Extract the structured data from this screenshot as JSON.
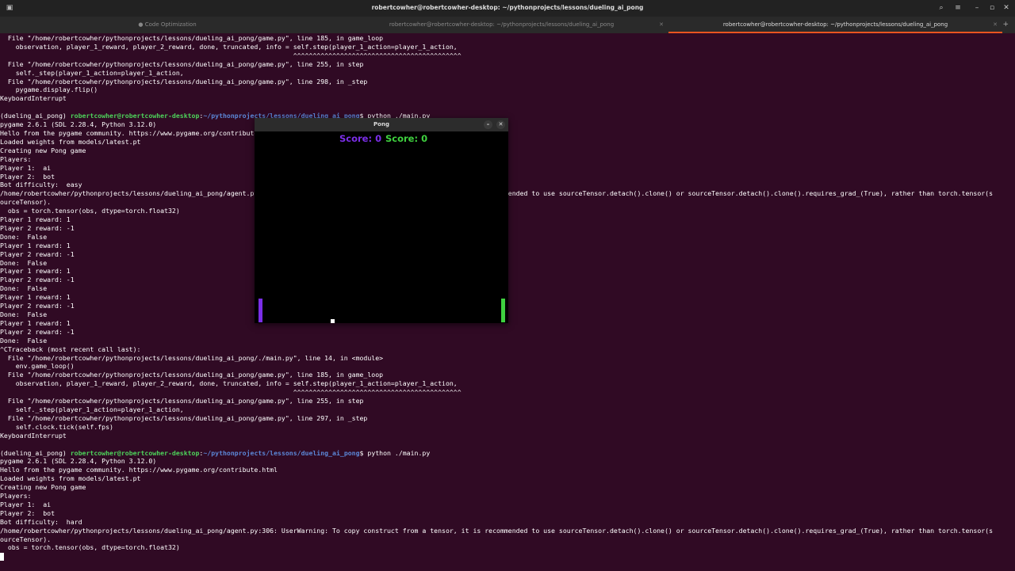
{
  "window": {
    "title": "robertcowher@robertcowher-desktop: ~/pythonprojects/lessons/dueling_ai_pong"
  },
  "tabs": [
    {
      "label": "Code Optimization",
      "prefix": "● ",
      "active": false
    },
    {
      "label": "robertcowher@robertcowher-desktop: ~/pythonprojects/lessons/dueling_ai_pong",
      "prefix": "",
      "active": false
    },
    {
      "label": "robertcowher@robertcowher-desktop: ~/pythonprojects/lessons/dueling_ai_pong",
      "prefix": "",
      "active": true
    }
  ],
  "prompt": {
    "env": "(dueling_ai_pong)",
    "user": "robertcowher@robertcowher-desktop",
    "path": "~/pythonprojects/lessons/dueling_ai_pong"
  },
  "terminal_lines": [
    "  File \"/home/robertcowher/pythonprojects/lessons/dueling_ai_pong/game.py\", line 185, in game_loop",
    "    observation, player_1_reward, player_2_reward, done, truncated, info = self.step(player_1_action=player_1_action,",
    "                                                                           ^^^^^^^^^^^^^^^^^^^^^^^^^^^^^^^^^^^^^^^^^^^",
    "  File \"/home/robertcowher/pythonprojects/lessons/dueling_ai_pong/game.py\", line 255, in step",
    "    self._step(player_1_action=player_1_action,",
    "  File \"/home/robertcowher/pythonprojects/lessons/dueling_ai_pong/game.py\", line 298, in _step",
    "    pygame.display.flip()",
    "KeyboardInterrupt",
    "",
    {
      "prompt": true,
      "cmd": "$ python ./main.py"
    },
    "pygame 2.6.1 (SDL 2.28.4, Python 3.12.0)",
    "Hello from the pygame community. https://www.pygame.org/contribute.html",
    "Loaded weights from models/latest.pt",
    "Creating new Pong game",
    "Players:",
    "Player 1:  ai",
    "Player 2:  bot",
    "Bot difficulty:  easy",
    "/home/robertcowher/pythonprojects/lessons/dueling_ai_pong/agent.py:306: UserWarning: To copy construct from a tensor, it is recommended to use sourceTensor.detach().clone() or sourceTensor.detach().clone().requires_grad_(True), rather than torch.tensor(s",
    "ourceTensor).",
    "  obs = torch.tensor(obs, dtype=torch.float32)",
    "Player 1 reward: 1",
    "Player 2 reward: -1",
    "Done:  False",
    "Player 1 reward: 1",
    "Player 2 reward: -1",
    "Done:  False",
    "Player 1 reward: 1",
    "Player 2 reward: -1",
    "Done:  False",
    "Player 1 reward: 1",
    "Player 2 reward: -1",
    "Done:  False",
    "Player 1 reward: 1",
    "Player 2 reward: -1",
    "Done:  False",
    "^CTraceback (most recent call last):",
    "  File \"/home/robertcowher/pythonprojects/lessons/dueling_ai_pong/./main.py\", line 14, in <module>",
    "    env.game_loop()",
    "  File \"/home/robertcowher/pythonprojects/lessons/dueling_ai_pong/game.py\", line 185, in game_loop",
    "    observation, player_1_reward, player_2_reward, done, truncated, info = self.step(player_1_action=player_1_action,",
    "                                                                           ^^^^^^^^^^^^^^^^^^^^^^^^^^^^^^^^^^^^^^^^^^^",
    "  File \"/home/robertcowher/pythonprojects/lessons/dueling_ai_pong/game.py\", line 255, in step",
    "    self._step(player_1_action=player_1_action,",
    "  File \"/home/robertcowher/pythonprojects/lessons/dueling_ai_pong/game.py\", line 297, in _step",
    "    self.clock.tick(self.fps)",
    "KeyboardInterrupt",
    "",
    {
      "prompt": true,
      "cmd": "$ python ./main.py"
    },
    "pygame 2.6.1 (SDL 2.28.4, Python 3.12.0)",
    "Hello from the pygame community. https://www.pygame.org/contribute.html",
    "Loaded weights from models/latest.pt",
    "Creating new Pong game",
    "Players:",
    "Player 1:  ai",
    "Player 2:  bot",
    "Bot difficulty:  hard",
    "/home/robertcowher/pythonprojects/lessons/dueling_ai_pong/agent.py:306: UserWarning: To copy construct from a tensor, it is recommended to use sourceTensor.detach().clone() or sourceTensor.detach().clone().requires_grad_(True), rather than torch.tensor(s",
    "ourceTensor).",
    "  obs = torch.tensor(obs, dtype=torch.float32)"
  ],
  "pong": {
    "title": "Pong",
    "score1_label": "Score: 0",
    "score2_label": "Score: 0",
    "player1_color": "#7b2ee8",
    "player2_color": "#3fd13f"
  },
  "icons": {
    "app": "terminal-app-icon",
    "search": "search-icon",
    "menu": "hamburger-menu-icon",
    "minimize": "minimize-icon",
    "maximize": "maximize-icon",
    "close": "close-icon"
  },
  "colors": {
    "terminal_bg": "#300a24",
    "prompt_user": "#4dd25a",
    "prompt_path": "#5b86d6",
    "tab_accent": "#e95420"
  }
}
